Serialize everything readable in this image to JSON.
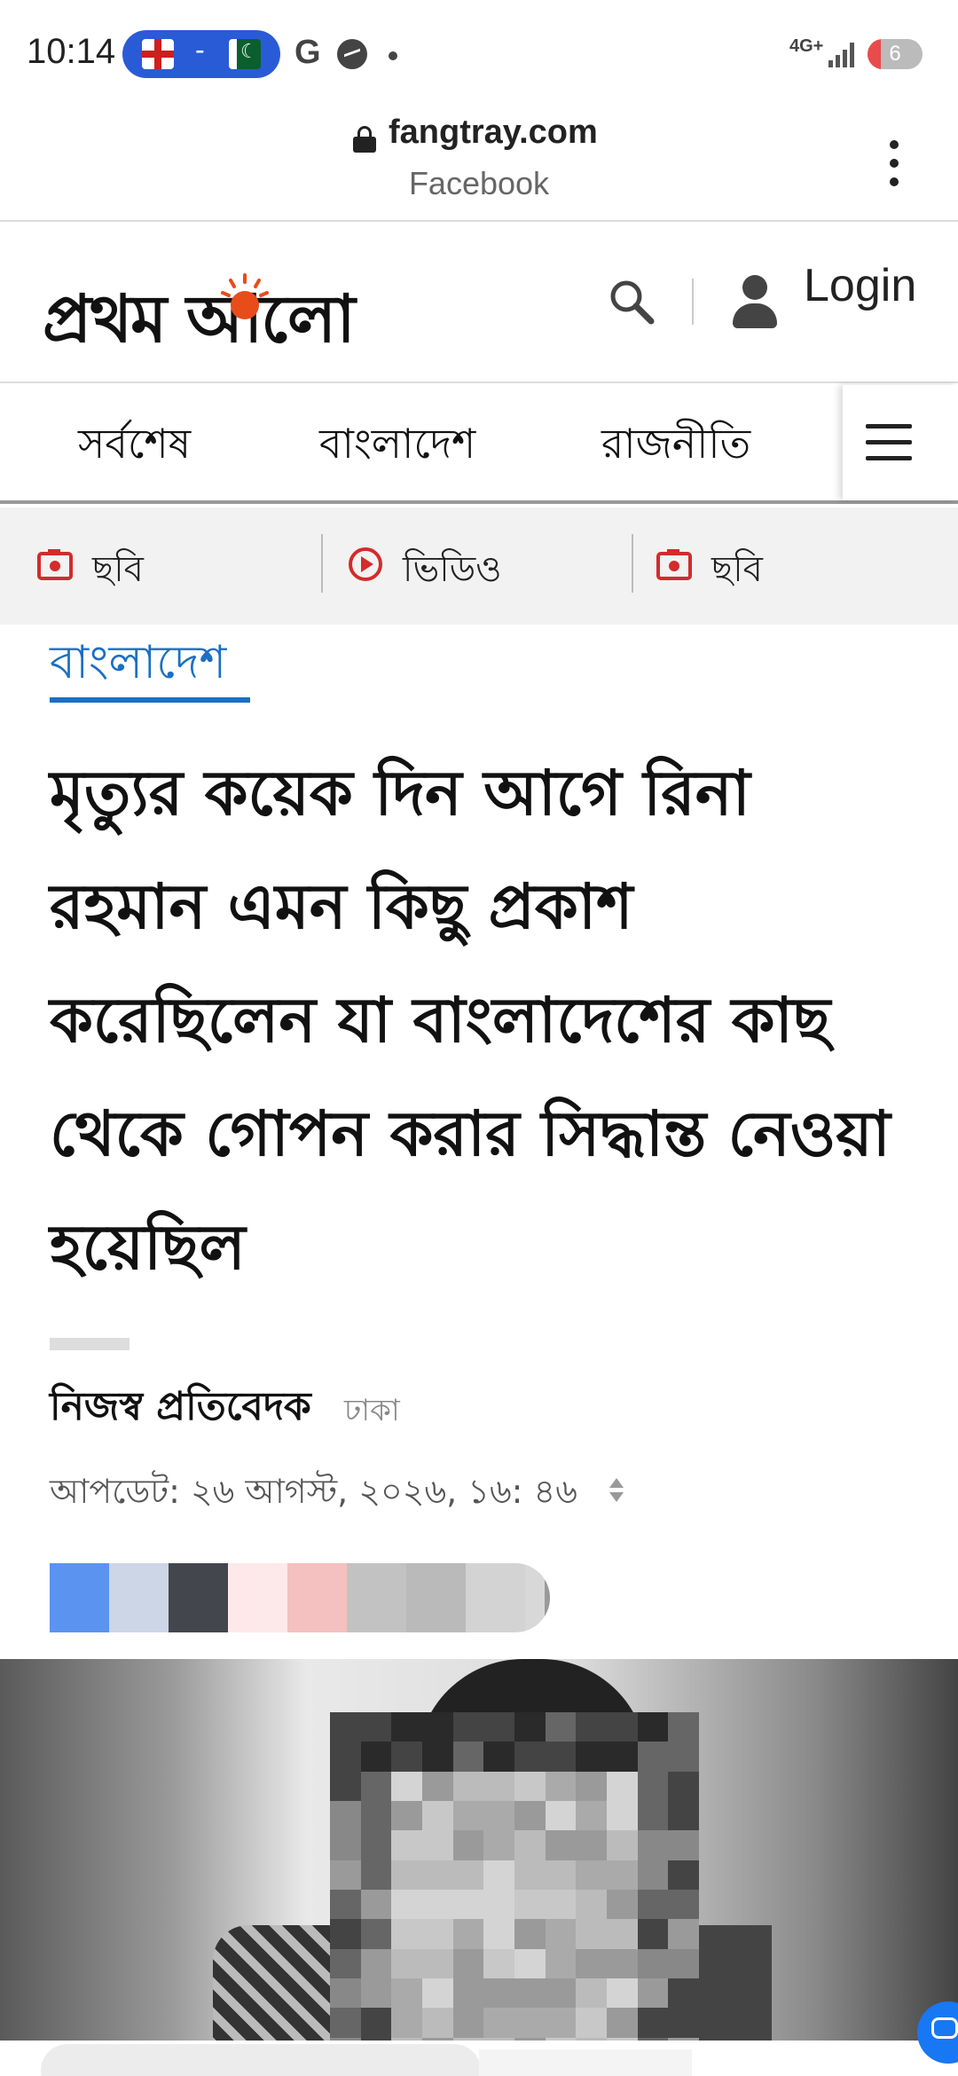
{
  "status_bar": {
    "time": "10:14",
    "score_separator": "-",
    "google_icon": "G",
    "network": "4G+",
    "battery_level": "6",
    "battery_fraction": 0.06,
    "colors": {
      "pill": "#2a5bd7",
      "battery_low": "#e94b4b"
    }
  },
  "browser": {
    "url": "fangtray.com",
    "subtitle": "Facebook"
  },
  "site_header": {
    "logo_text": "প্রথম আলো",
    "login_label": "Login"
  },
  "categories": [
    "সর্বশেষ",
    "বাংলাদেশ",
    "রাজনীতি"
  ],
  "sub_nav": [
    {
      "icon": "camera-icon",
      "label": "ছবি"
    },
    {
      "icon": "play-icon",
      "label": "ভিডিও"
    },
    {
      "icon": "camera-icon",
      "label": "ছবি"
    }
  ],
  "article": {
    "section": "বাংলাদেশ",
    "headline": "মৃত্যুর কয়েক দিন আগে রিনা রহমান এমন কিছু প্রকাশ করেছিলেন যা বাংলাদেশের কাছ থেকে গোপন করার সিদ্ধান্ত নেওয়া হয়েছিল",
    "author": "নিজস্ব প্রতিবেদক",
    "location": "ঢাকা",
    "updated": "আপডেট: ২৬ আগস্ট, ২০২৬, ১৬: ৪৬"
  },
  "share_colors": [
    "#5b93f0",
    "#cdd6e6",
    "#43464d",
    "#fde9e9",
    "#f5c0c0",
    "#c2c2c2",
    "#bababa",
    "#d3d3d3"
  ],
  "accent": "#1b6fc4"
}
